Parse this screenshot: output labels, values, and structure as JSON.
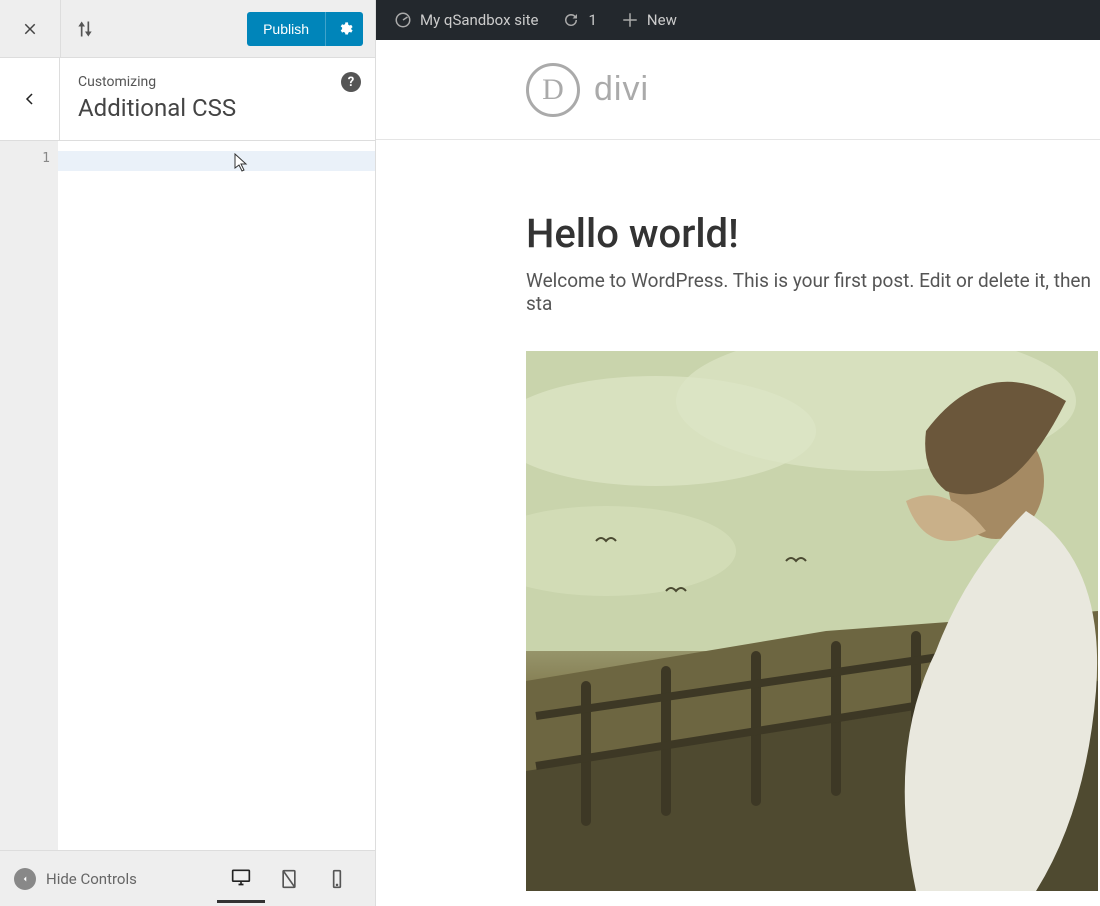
{
  "customizer": {
    "publish_label": "Publish",
    "section_label": "Customizing",
    "section_title": "Additional CSS",
    "help_symbol": "?",
    "editor": {
      "line_numbers": [
        "1"
      ],
      "code_lines": [
        ""
      ]
    },
    "footer": {
      "hide_controls_label": "Hide Controls",
      "active_device": "desktop"
    }
  },
  "adminbar": {
    "site_name": "My qSandbox site",
    "update_count": "1",
    "new_label": "New"
  },
  "preview": {
    "logo_letter": "D",
    "logo_text": "divi",
    "post_title": "Hello world!",
    "post_body": "Welcome to WordPress. This is your first post. Edit or delete it, then sta"
  }
}
